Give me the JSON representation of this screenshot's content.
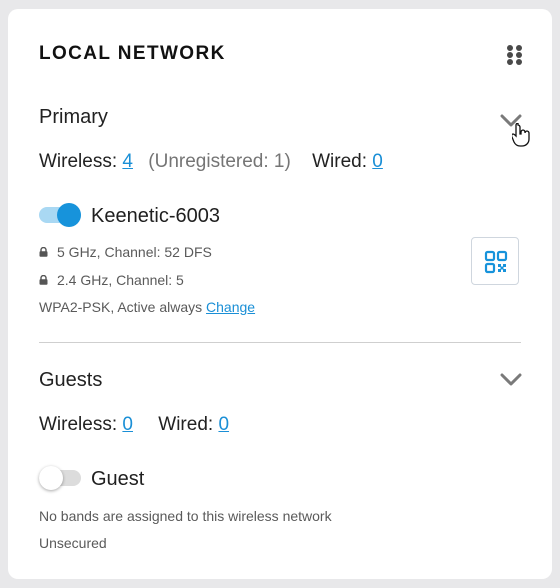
{
  "panel": {
    "title": "LOCAL NETWORK",
    "drag_icon": "grip-dots-icon"
  },
  "primary": {
    "section_title": "Primary",
    "expand_icon": "chevron-down-icon",
    "wireless_label": "Wireless:",
    "wireless_count": "4",
    "unregistered_text": "(Unregistered: 1)",
    "wired_label": "Wired:",
    "wired_count": "0",
    "network": {
      "enabled": true,
      "name": "Keenetic-6003",
      "band1": "5 GHz, Channel: 52 DFS",
      "band2": "2.4 GHz, Channel: 5",
      "security_text": "WPA2-PSK, Active always",
      "change_link": "Change",
      "qr_icon": "qr-code-icon",
      "lock_icon": "lock-icon"
    }
  },
  "guests": {
    "section_title": "Guests",
    "expand_icon": "chevron-down-icon",
    "wireless_label": "Wireless:",
    "wireless_count": "0",
    "wired_label": "Wired:",
    "wired_count": "0",
    "network": {
      "enabled": false,
      "name": "Guest",
      "info_line1": "No bands are assigned to this wireless network",
      "info_line2": "Unsecured"
    }
  },
  "colors": {
    "accent": "#1793db",
    "link": "#1a8fd6",
    "toggle_track_on": "#a9d8f3",
    "muted_text": "#757575"
  }
}
